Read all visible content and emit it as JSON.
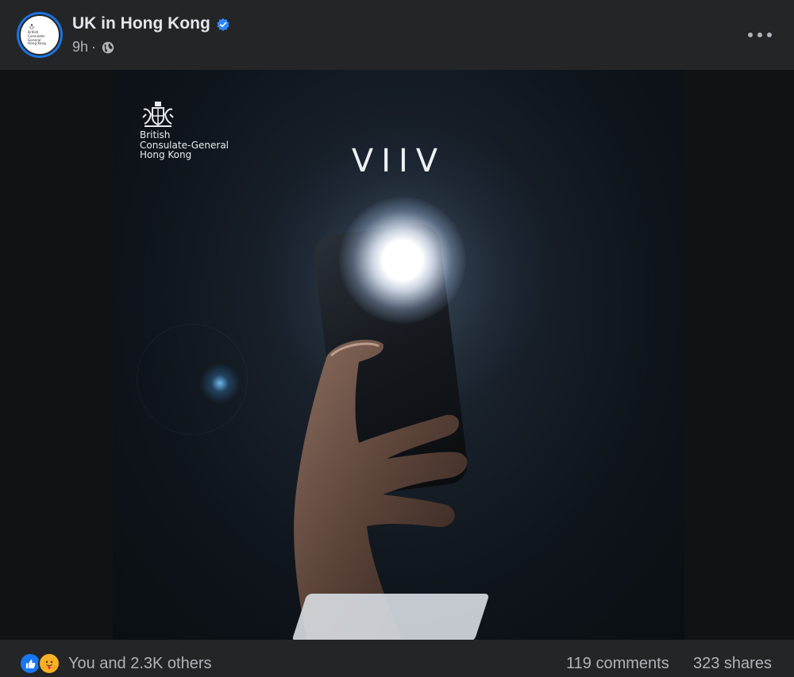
{
  "post": {
    "page_name": "UK in Hong Kong",
    "time": "9h",
    "separator": "·",
    "verified_icon": "verified-badge-icon",
    "privacy_icon": "globe-icon",
    "more_icon": "more-horizontal-icon"
  },
  "avatar": {
    "lines": [
      "British",
      "Consulate-General",
      "Hong Kong"
    ]
  },
  "image": {
    "brand_lines": [
      "British",
      "Consulate-General",
      "Hong Kong"
    ],
    "headline": "VIIV"
  },
  "footer": {
    "reactions_text": "You and 2.3K others",
    "comments": "119 comments",
    "shares": "323 shares",
    "reaction_icons": [
      "like-reaction-icon",
      "care-reaction-icon"
    ]
  },
  "colors": {
    "background": "#242526",
    "text_primary": "#e4e6eb",
    "text_secondary": "#b0b3b8",
    "accent": "#1877f2",
    "care_yellow": "#f7b125"
  }
}
